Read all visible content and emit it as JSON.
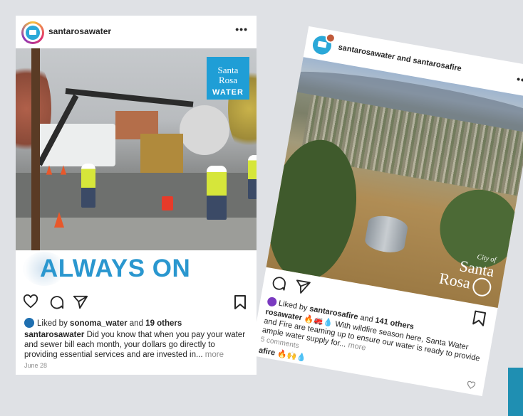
{
  "post1": {
    "username": "santarosawater",
    "more": "•••",
    "logo_line1": "Santa",
    "logo_line2": "Rosa",
    "logo_line3": "WATER",
    "banner": "ALWAYS ON",
    "likes_prefix": "Liked by",
    "likes_user": "sonoma_water",
    "likes_mid": "and",
    "likes_count": "19 others",
    "caption_user": "santarosawater",
    "caption_text": "Did you know that when you pay your water and sewer bill each month, your dollars go directly to providing essential services and are invested in...",
    "more_link": "more",
    "date": "June 28"
  },
  "post2": {
    "username": "santarosawater and santarosafire",
    "more": "•••",
    "logo_city": "City of",
    "logo_name1": "Santa",
    "logo_name2": "Rosa",
    "likes_prefix": "Liked by",
    "likes_user": "santarosafire",
    "likes_mid": "and",
    "likes_count": "141 others",
    "caption_user": "rosawater",
    "caption_emoji": "🔥🚒💧",
    "caption_text": "With wildfire season here, Santa Water and Fire are teaming up to ensure our water is ready to provide ample water supply for...",
    "more_link": "more",
    "comments": "5 comments",
    "comment_user": "afire",
    "comment_emoji": "🔥🙌💧"
  },
  "colors": {
    "accent": "#2a97cf",
    "background": "#dfe1e5",
    "teal_block": "#1f8fb2"
  }
}
